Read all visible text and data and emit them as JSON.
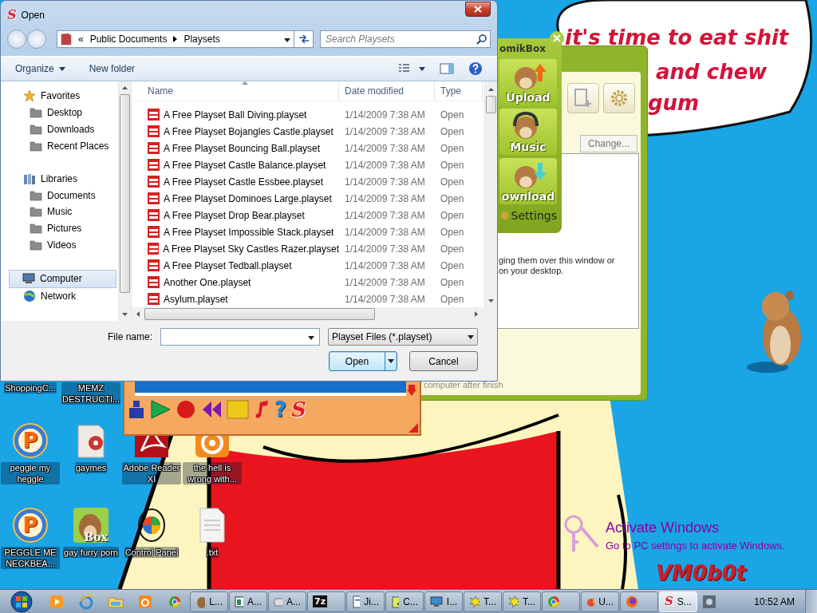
{
  "dialog": {
    "logo": "S",
    "title": "Open",
    "path_overflow": "«",
    "breadcrumb": [
      "Public Documents",
      "Playsets"
    ],
    "search": {
      "placeholder": "Search Playsets"
    },
    "toolbar": {
      "organize": "Organize",
      "new_folder": "New folder"
    },
    "nav": [
      {
        "label": "Favorites",
        "selected": false,
        "children": [
          {
            "label": "Desktop",
            "selected": false
          },
          {
            "label": "Downloads",
            "selected": false
          },
          {
            "label": "Recent Places",
            "selected": false
          }
        ]
      },
      {
        "label": "Libraries",
        "selected": false,
        "children": [
          {
            "label": "Documents",
            "selected": false
          },
          {
            "label": "Music",
            "selected": false
          },
          {
            "label": "Pictures",
            "selected": false
          },
          {
            "label": "Videos",
            "selected": false
          }
        ]
      },
      {
        "label": "Computer",
        "selected": true
      },
      {
        "label": "Network",
        "selected": false
      }
    ],
    "columns": [
      "Name",
      "Date modified",
      "Type"
    ],
    "files": [
      {
        "name": "A Free Playset Ball Diving.playset",
        "date": "1/14/2009 7:38 AM",
        "type": "Open"
      },
      {
        "name": "A Free Playset Bojangles Castle.playset",
        "date": "1/14/2009 7:38 AM",
        "type": "Open"
      },
      {
        "name": "A Free Playset Bouncing Ball.playset",
        "date": "1/14/2009 7:38 AM",
        "type": "Open"
      },
      {
        "name": "A Free Playset Castle Balance.playset",
        "date": "1/14/2009 7:38 AM",
        "type": "Open"
      },
      {
        "name": "A Free Playset Castle Essbee.playset",
        "date": "1/14/2009 7:38 AM",
        "type": "Open"
      },
      {
        "name": "A Free Playset Dominoes Large.playset",
        "date": "1/14/2009 7:38 AM",
        "type": "Open"
      },
      {
        "name": "A Free Playset Drop Bear.playset",
        "date": "1/14/2009 7:38 AM",
        "type": "Open"
      },
      {
        "name": "A Free Playset Impossible Stack.playset",
        "date": "1/14/2009 7:38 AM",
        "type": "Open"
      },
      {
        "name": "A Free Playset Sky Castles Razer.playset",
        "date": "1/14/2009 7:38 AM",
        "type": "Open"
      },
      {
        "name": "A Free Playset Tedball.playset",
        "date": "1/14/2009 7:38 AM",
        "type": "Open"
      },
      {
        "name": "Another One.playset",
        "date": "1/14/2009 7:38 AM",
        "type": "Open"
      },
      {
        "name": "Asylum.playset",
        "date": "1/14/2009 7:38 AM",
        "type": "Open"
      }
    ],
    "file_name": {
      "label": "File name:"
    },
    "filter": "Playset Files (*.playset)",
    "buttons": [
      {
        "label": "Open",
        "kind": "split",
        "default": true
      },
      {
        "label": "Cancel",
        "kind": "plain",
        "default": false
      }
    ]
  },
  "homik": {
    "title": "omikBox",
    "buttons": [
      {
        "label": "Upload",
        "kind": "up"
      },
      {
        "label": "Music",
        "kind": "music"
      },
      {
        "label": "ownload",
        "kind": "down"
      }
    ],
    "settings": "Settings",
    "change": "Change...",
    "hint": [
      "ging them over this window or",
      "on your desktop."
    ],
    "footer": "computer after finish"
  },
  "player": {
    "help": "?",
    "logo": "S"
  },
  "bubble": [
    "it's time to eat shit",
    "and chew",
    "gum"
  ],
  "desktop_icons": [
    {
      "label": "ShoppingC...",
      "kind": "hidden"
    },
    {
      "label": "MEMZ DESTRUCTI...",
      "kind": "hidden"
    },
    {
      "label": "peggle my heggle",
      "kind": "peggle",
      "glyph": "P"
    },
    {
      "label": "gaymes",
      "kind": "folder"
    },
    {
      "label": "Adobe Reader XI",
      "kind": "pdf"
    },
    {
      "label": "the hell is wrong with...",
      "kind": "browser"
    },
    {
      "label": "PEGGLE ME NECKBEA...",
      "kind": "peggle",
      "glyph": "P"
    },
    {
      "label": "gay furry porn",
      "kind": "box",
      "glyph": "Box"
    },
    {
      "label": "Control Panel",
      "kind": "panel"
    },
    {
      "label": ".txt",
      "kind": "text"
    }
  ],
  "activation": {
    "title": "Activate Windows",
    "message": "Go to PC settings to activate Windows."
  },
  "signature": "VM0b0t",
  "taskbar": [
    {
      "kind": "start"
    },
    {
      "kind": "media"
    },
    {
      "kind": "ie"
    },
    {
      "kind": "explorer"
    },
    {
      "kind": "uc"
    },
    {
      "kind": "chrome"
    },
    {
      "kind": "task",
      "label": "L..."
    },
    {
      "kind": "task",
      "label": "A..."
    },
    {
      "kind": "task",
      "label": "A..."
    },
    {
      "kind": "task",
      "glyph": "7z"
    },
    {
      "kind": "task",
      "label": "Ji..."
    },
    {
      "kind": "task",
      "label": "C..."
    },
    {
      "kind": "task",
      "label": "I..."
    },
    {
      "kind": "task",
      "label": "T..."
    },
    {
      "kind": "task",
      "label": "T..."
    },
    {
      "kind": "task"
    },
    {
      "kind": "task",
      "label": "U..."
    },
    {
      "kind": "task"
    },
    {
      "kind": "task",
      "glyph": "S",
      "label": "S...",
      "selected": true
    }
  ],
  "clock": "10:52 AM"
}
